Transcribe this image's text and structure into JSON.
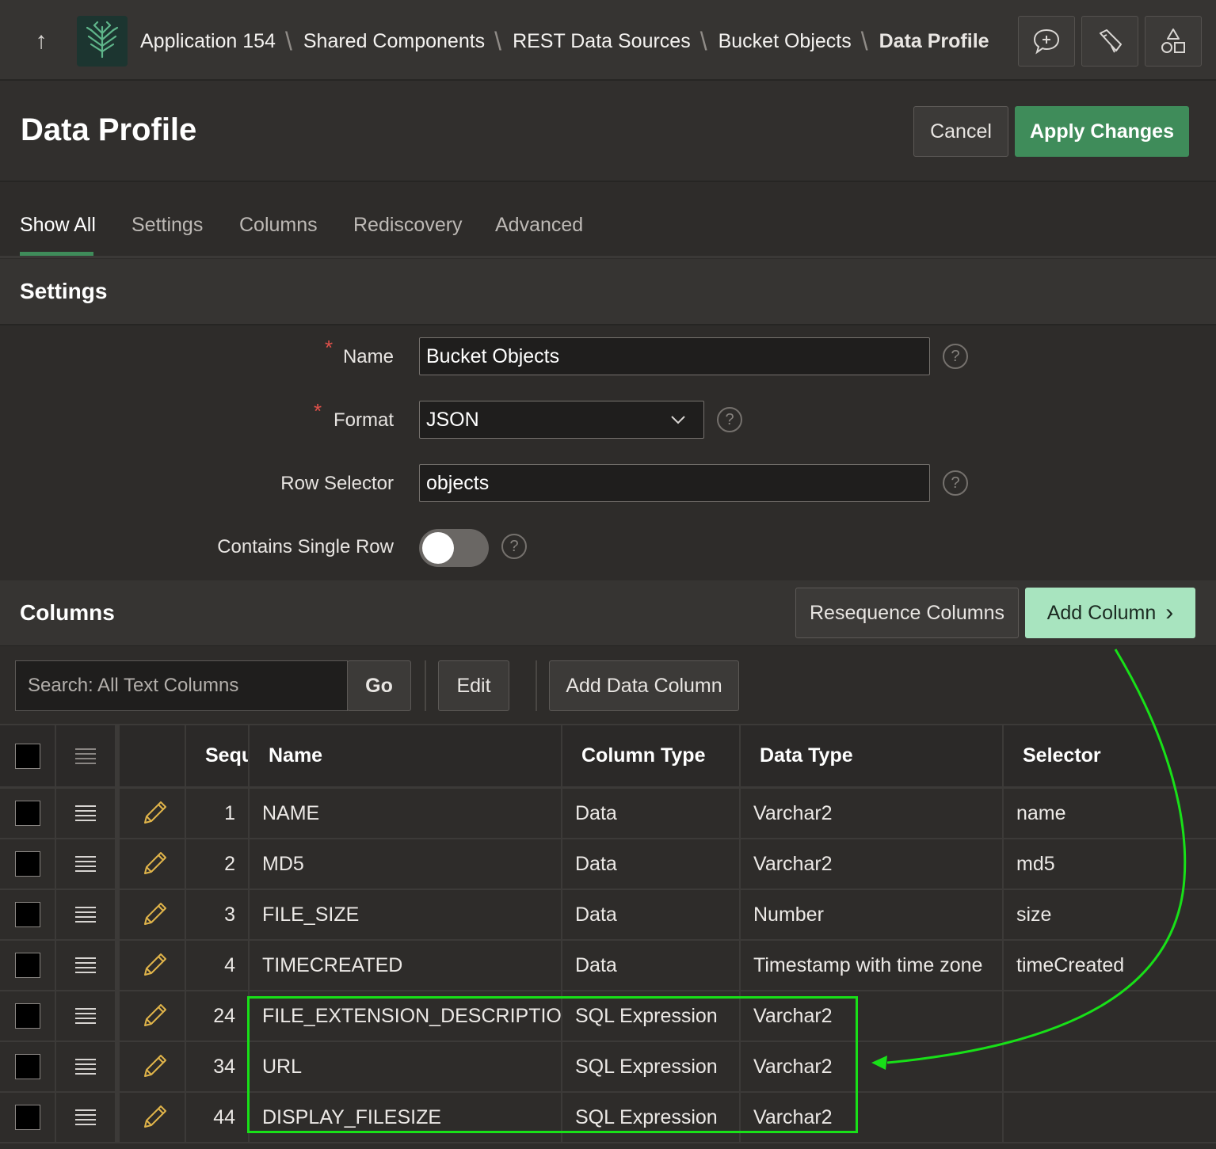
{
  "topbar": {
    "breadcrumbs": [
      "Application 154",
      "Shared Components",
      "REST Data Sources",
      "Bucket Objects"
    ],
    "breadcrumb_current": "Data Profile",
    "icons": [
      "up-arrow-icon",
      "app-logo-icon",
      "feedback-icon",
      "developer-toolbar-icon",
      "shared-components-icon"
    ]
  },
  "page": {
    "title": "Data Profile",
    "cancel_label": "Cancel",
    "apply_label": "Apply Changes"
  },
  "tabs": [
    {
      "label": "Show All",
      "active": true
    },
    {
      "label": "Settings",
      "active": false
    },
    {
      "label": "Columns",
      "active": false
    },
    {
      "label": "Rediscovery",
      "active": false
    },
    {
      "label": "Advanced",
      "active": false
    }
  ],
  "settings": {
    "title": "Settings",
    "name_label": "Name",
    "name_value": "Bucket Objects",
    "format_label": "Format",
    "format_value": "JSON",
    "row_selector_label": "Row Selector",
    "row_selector_value": "objects",
    "single_row_label": "Contains Single Row",
    "single_row_on": false,
    "help_glyph": "?",
    "required_glyph": "*"
  },
  "columns_region": {
    "title": "Columns",
    "resequence_label": "Resequence Columns",
    "add_column_label": "Add Column",
    "add_column_chevron": "›",
    "search_placeholder": "Search: All Text Columns",
    "go_label": "Go",
    "edit_label": "Edit",
    "add_data_column_label": "Add Data Column"
  },
  "grid": {
    "headers": [
      "Sequ",
      "Name",
      "Column Type",
      "Data Type",
      "Selector"
    ],
    "rows": [
      {
        "seq": "1",
        "name": "NAME",
        "column_type": "Data",
        "data_type": "Varchar2",
        "selector": "name"
      },
      {
        "seq": "2",
        "name": "MD5",
        "column_type": "Data",
        "data_type": "Varchar2",
        "selector": "md5"
      },
      {
        "seq": "3",
        "name": "FILE_SIZE",
        "column_type": "Data",
        "data_type": "Number",
        "selector": "size"
      },
      {
        "seq": "4",
        "name": "TIMECREATED",
        "column_type": "Data",
        "data_type": "Timestamp with time zone",
        "selector": "timeCreated"
      },
      {
        "seq": "24",
        "name": "FILE_EXTENSION_DESCRIPTION",
        "column_type": "SQL Expression",
        "data_type": "Varchar2",
        "selector": ""
      },
      {
        "seq": "34",
        "name": "URL",
        "column_type": "SQL Expression",
        "data_type": "Varchar2",
        "selector": ""
      },
      {
        "seq": "44",
        "name": "DISPLAY_FILESIZE",
        "column_type": "SQL Expression",
        "data_type": "Varchar2",
        "selector": ""
      }
    ]
  },
  "colors": {
    "accent_green": "#3f8c5a",
    "add_column_bg": "#a8e4bf",
    "annotation_green": "#18e018",
    "required_red": "#e0514a"
  }
}
